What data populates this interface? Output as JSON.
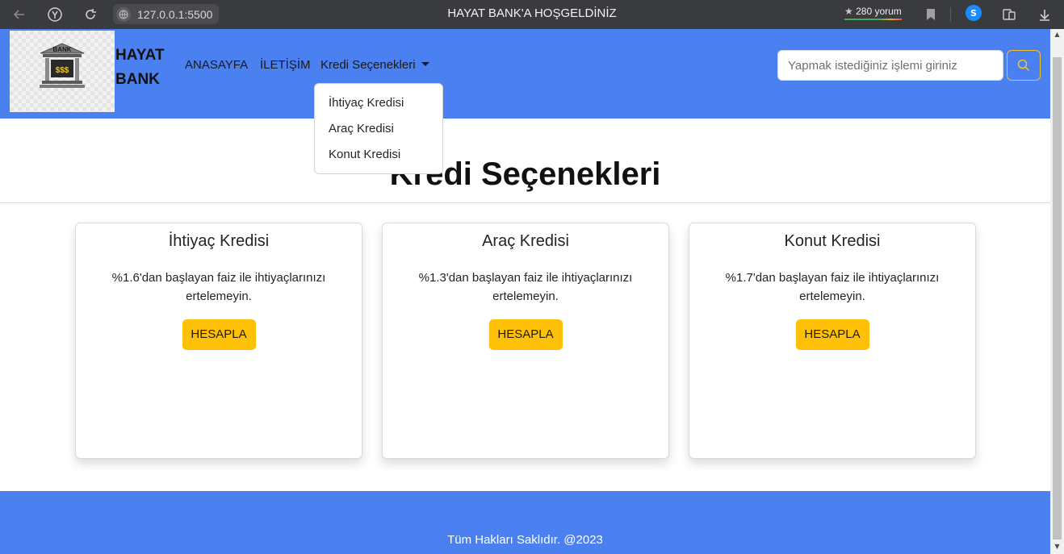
{
  "browser": {
    "url": "127.0.0.1:5500",
    "tab_title": "HAYAT BANK'A HOŞGELDİNİZ",
    "reviews_star": "★",
    "reviews_text": "280 yorum",
    "icons": [
      "back-arrow-icon",
      "yandex-icon",
      "reload-icon",
      "globe-icon",
      "bookmark-icon",
      "shazam-icon",
      "extensions-icon",
      "download-icon"
    ]
  },
  "navbar": {
    "brand_line1": "HAYAT",
    "brand_line2": "BANK",
    "logo_text": "BANK",
    "logo_money": "$$$",
    "links": {
      "home": "ANASAYFA",
      "contact": "İLETİŞİM",
      "credit_options": "Kredi Seçenekleri"
    },
    "search": {
      "placeholder": "Yapmak istediğiniz işlemi giriniz"
    },
    "colors": {
      "background": "#4a80f0",
      "search_button_border": "#f2c230"
    }
  },
  "dropdown": {
    "items": [
      "İhtiyaç Kredisi",
      "Araç Kredisi",
      "Konut Kredisi"
    ]
  },
  "main": {
    "heading": "Kredi Seçenekleri",
    "cards": [
      {
        "title": "İhtiyaç Kredisi",
        "text": "%1.6'dan başlayan faiz ile ihtiyaçlarınızı ertelemeyin.",
        "button": "HESAPLA"
      },
      {
        "title": "Araç Kredisi",
        "text": "%1.3'dan başlayan faiz ile ihtiyaçlarınızı ertelemeyin.",
        "button": "HESAPLA"
      },
      {
        "title": "Konut Kredisi",
        "text": "%1.7'dan başlayan faiz ile ihtiyaçlarınızı ertelemeyin.",
        "button": "HESAPLA"
      }
    ],
    "colors": {
      "button": "#ffc107"
    }
  },
  "footer": {
    "text": "Tüm Hakları Saklıdır. @2023"
  }
}
